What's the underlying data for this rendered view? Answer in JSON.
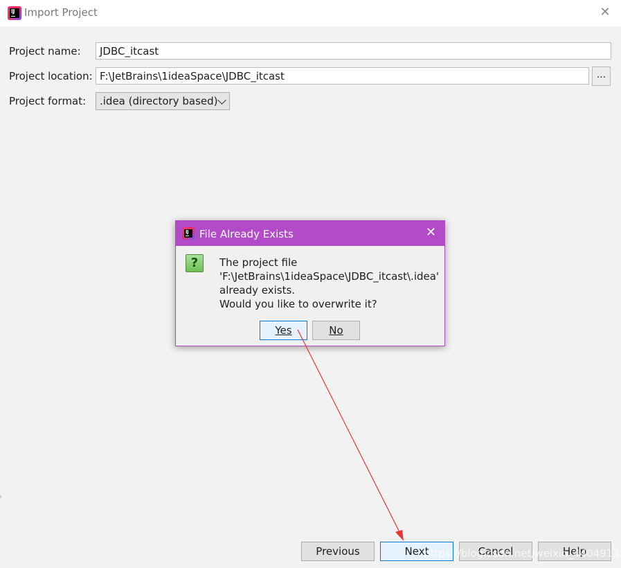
{
  "window": {
    "title": "Import Project",
    "close_glyph": "✕"
  },
  "form": {
    "name_label": "Project name:",
    "name_value": "JDBC_itcast",
    "location_label": "Project location:",
    "location_value": "F:\\JetBrains\\1ideaSpace\\JDBC_itcast",
    "browse_label": "...",
    "format_label": "Project format:",
    "format_value": ".idea (directory based)"
  },
  "footer": {
    "previous_label": "Previous",
    "next_label": "Next",
    "cancel_label": "Cancel",
    "help_label": "Help"
  },
  "watermark": "https://blog.csdn.net/weixin_44049135",
  "dialog": {
    "title": "File Already Exists",
    "close_glyph": "✕",
    "icon": "question-icon",
    "lines": [
      "The project file",
      "'F:\\JetBrains\\1ideaSpace\\JDBC_itcast\\.idea'",
      "already exists.",
      "Would you like to overwrite it?"
    ],
    "yes_label": "Yes",
    "no_label": "No"
  },
  "colors": {
    "dialog_accent": "#b14bc8",
    "annotation_arrow": "#e53935"
  }
}
